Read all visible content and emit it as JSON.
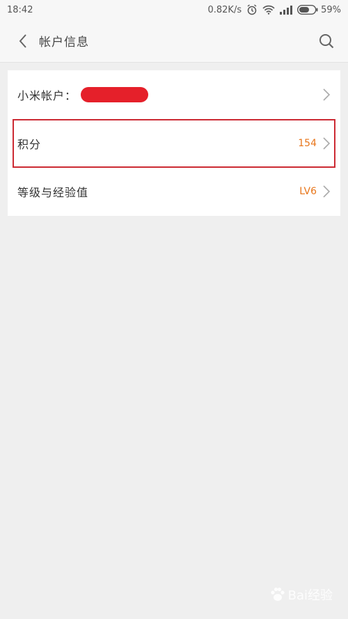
{
  "status_bar": {
    "time": "18:42",
    "network_speed": "0.82K/s",
    "battery": "59%"
  },
  "header": {
    "title": "帐户信息"
  },
  "rows": [
    {
      "label": "小米帐户：",
      "value": ""
    },
    {
      "label": "积分",
      "value": "154"
    },
    {
      "label": "等级与经验值",
      "value": "LV6"
    }
  ],
  "watermark": {
    "text": "Bai经验"
  },
  "colors": {
    "accent": "#e8761b",
    "highlight": "#cc2a33",
    "redaction": "#e5202a"
  }
}
